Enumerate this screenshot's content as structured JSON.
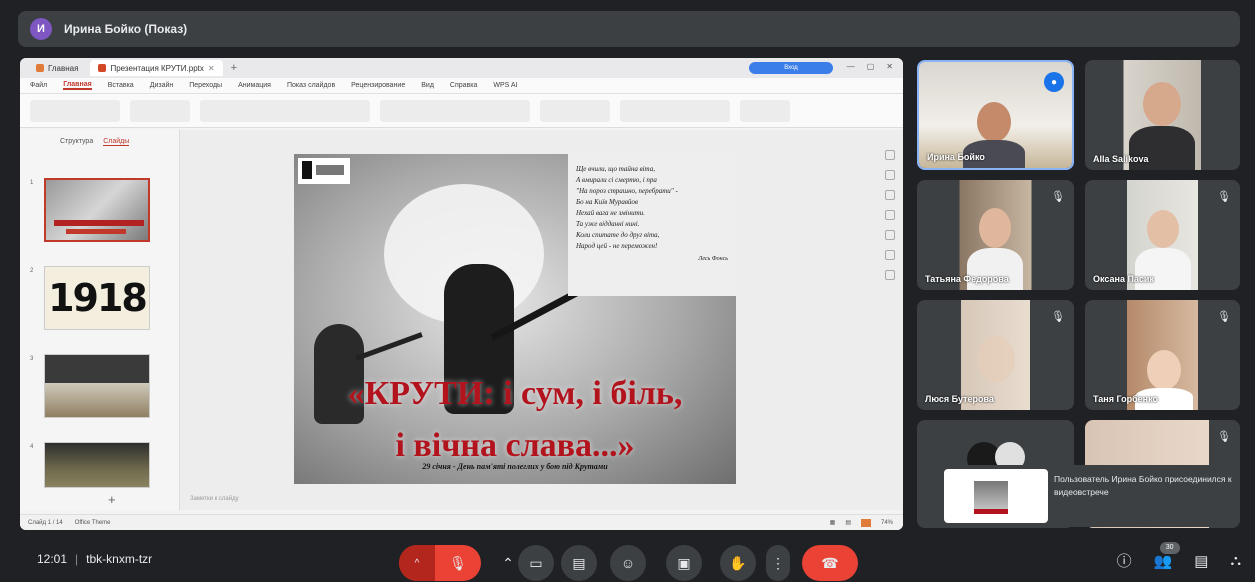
{
  "presenter": {
    "avatar_letter": "И",
    "name": "Ирина Бойко (Показ)"
  },
  "shared_screen": {
    "tabs": [
      {
        "label": "Главная"
      },
      {
        "label": "Презентация КРУТИ.pptx"
      }
    ],
    "login_label": "Вход",
    "menu": [
      "Файл",
      "Главная",
      "Вставка",
      "Дизайн",
      "Переходы",
      "Анимация",
      "Показ слайдов",
      "Рецензирование",
      "Вид",
      "Справка",
      "WPS AI"
    ],
    "thumb_tabs": [
      "Структура",
      "Слайды"
    ],
    "thumbnails": [
      {
        "num": "1"
      },
      {
        "num": "2",
        "text": "1918"
      },
      {
        "num": "3"
      },
      {
        "num": "4"
      }
    ],
    "add_slide": "+",
    "slide": {
      "poem": [
        "Ще вчили, що тайна віта,",
        "А вмирали сі смертю, і пра",
        "\"На пороз страшно, перебрати\" -",
        "Бо    на    Київ    Муравйов",
        "Нехай вага не змінити.",
        "Та   уже   відданні   нині.",
        "Коли спитате до друг віта,",
        "Народ цей - не переможен!"
      ],
      "poem_author": "Лесь Фонсь",
      "title_line1": "«КРУТИ: і сум, і біль,",
      "title_line2": "і вічна слава...»",
      "subtitle": "29 січня - День пам'яті полеглих у бою під Крутами"
    },
    "notes_placeholder": "Заметки к слайду",
    "status": {
      "slide_counter": "Слайд 1 / 14",
      "theme": "Office Theme",
      "zoom": "74%"
    }
  },
  "participants": [
    {
      "name": "Ирина Бойко",
      "speaking": true
    },
    {
      "name": "Alla Salikova"
    },
    {
      "name": "Татьяна Федорова"
    },
    {
      "name": "Оксана Пасик"
    },
    {
      "name": "Люся Бутерова"
    },
    {
      "name": "Таня Горбенко"
    },
    {
      "name": ""
    },
    {
      "name": ""
    }
  ],
  "toast": {
    "text": "Пользователь Ирина Бойко присоединился к видеовстрече"
  },
  "bottom": {
    "time": "12:01",
    "meeting_code": "tbk-knxm-tzr",
    "people_count": "30"
  }
}
